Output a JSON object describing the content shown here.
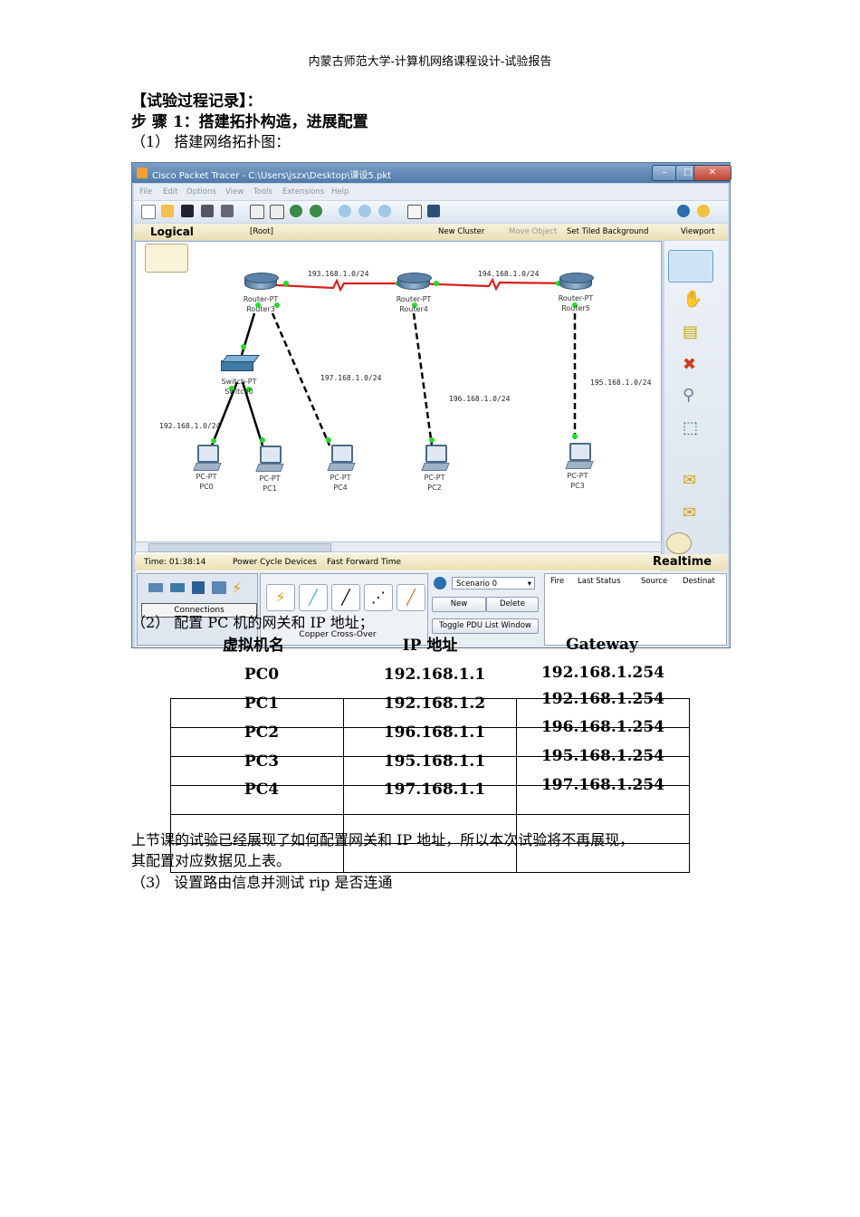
{
  "header": "内蒙古师范大学-计算机网络课程设计-试验报告",
  "section_title": "【试验过程记录】：",
  "step_title": "步 骤   1：搭建拓扑构造，进展配置",
  "sub1": "（1） 搭建网络拓扑图：",
  "sub2": "（2） 配置 PC 机的网关和  IP  地址；",
  "paragraph_line1": "上节课的试验已经展现了如何配置网关和  IP 地址，所以本次试验将不再展现，",
  "paragraph_line2": "其配置对应数据见上表。",
  "sub3": "（3） 设置路由信息并测试  rip 是否连通",
  "packet_tracer": {
    "title": "Cisco Packet Tracer - C:\\Users\\jszx\\Desktop\\课设5.pkt",
    "menu": [
      "File",
      "Edit",
      "Options",
      "View",
      "Tools",
      "Extensions",
      "Help"
    ],
    "logical": "Logical",
    "root": "[Root]",
    "new_cluster": "New Cluster",
    "move_object": "Move Object",
    "set_tiled_bg": "Set Tiled Background",
    "viewport": "Viewport",
    "time": "Time: 01:38:14",
    "power_cycle": "Power Cycle Devices",
    "fast_forward": "Fast Forward Time",
    "realtime": "Realtime",
    "connections": "Connections",
    "copper_crossover": "Copper Cross-Over",
    "scenario": "Scenario 0",
    "new_btn": "New",
    "delete_btn": "Delete",
    "toggle_pdu": "Toggle PDU List Window",
    "pdu_cols": [
      "Fire",
      "Last Status",
      "Source",
      "Destinat"
    ],
    "devices": {
      "router3_type": "Router-PT",
      "router3_name": "Router3",
      "router4_type": "Router-PT",
      "router4_name": "Router4",
      "router5_type": "Router-PT",
      "router5_name": "Router5",
      "switch_type": "Switch-PT",
      "switch_name": "Switch0",
      "pc0_type": "PC-PT",
      "pc0_name": "PC0",
      "pc1_type": "PC-PT",
      "pc1_name": "PC1",
      "pc4_type": "PC-PT",
      "pc4_name": "PC4",
      "pc2_type": "PC-PT",
      "pc2_name": "PC2",
      "pc3_type": "PC-PT",
      "pc3_name": "PC3"
    },
    "networks": {
      "n193": "193.168.1.0/24",
      "n194": "194.168.1.0/24",
      "n197": "197.168.1.0/24",
      "n196": "196.168.1.0/24",
      "n195": "195.168.1.0/24",
      "n192": "192.168.1.0/24"
    }
  },
  "ip_table": {
    "headers": [
      "虚拟机名",
      "IP 地址",
      "Gateway"
    ],
    "rows": [
      [
        "PC0",
        "192.168.1.1",
        "192.168.1.254"
      ],
      [
        "PC1",
        "192.168.1.2",
        "192.168.1.254"
      ],
      [
        "PC2",
        "196.168.1.1",
        "196.168.1.254"
      ],
      [
        "PC3",
        "195.168.1.1",
        "195.168.1.254"
      ],
      [
        "PC4",
        "197.168.1.1",
        "197.168.1.254"
      ]
    ]
  }
}
